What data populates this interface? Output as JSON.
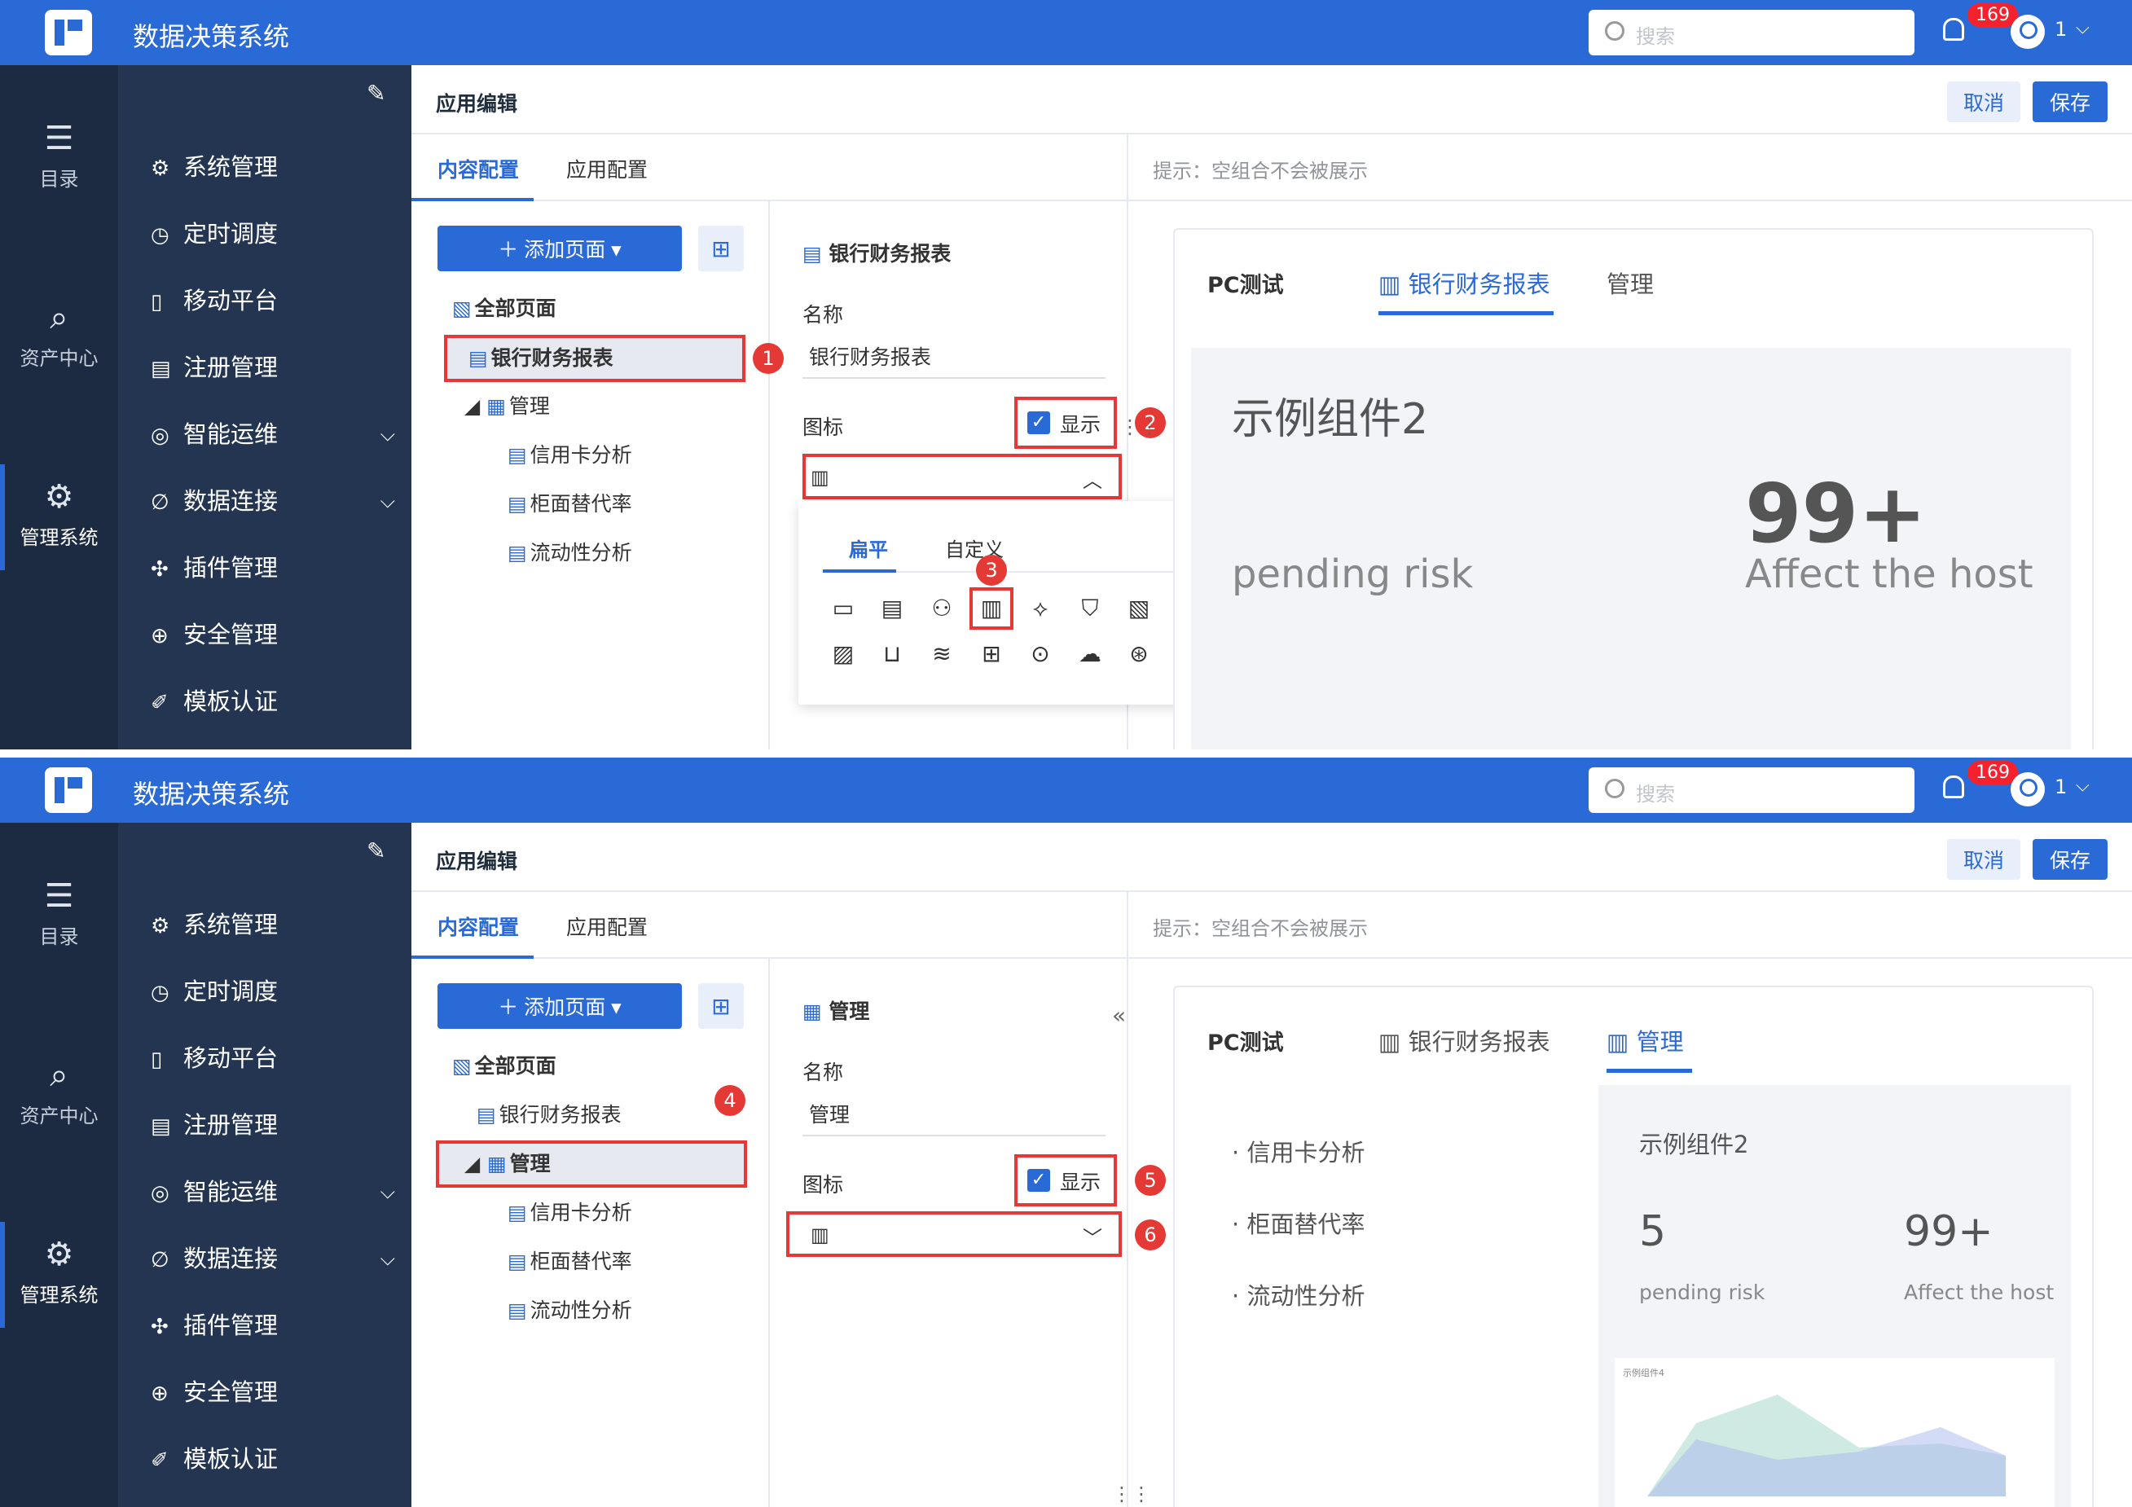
{
  "app": {
    "title": "数据决策系统",
    "search_placeholder": "搜索",
    "notif_count": "169",
    "user": "1"
  },
  "rail": [
    {
      "label": "目录"
    },
    {
      "label": "资产中心"
    },
    {
      "label": "管理系统"
    }
  ],
  "menu": [
    "系统管理",
    "定时调度",
    "移动平台",
    "注册管理",
    "智能运维",
    "数据连接",
    "插件管理",
    "安全管理",
    "模板认证"
  ],
  "editor": {
    "title": "应用编辑",
    "cancel": "取消",
    "save": "保存",
    "tab_content": "内容配置",
    "tab_app": "应用配置",
    "tip": "提示：空组合不会被展示"
  },
  "tree": {
    "add_page": "添加页面",
    "all_pages": "全部页面",
    "bank_report": "银行财务报表",
    "manage": "管理",
    "children": [
      "信用卡分析",
      "柜面替代率",
      "流动性分析"
    ]
  },
  "props": {
    "name_label": "名称",
    "icon_label": "图标",
    "show": "显示"
  },
  "screen1": {
    "prop_title": "银行财务报表",
    "name_value": "银行财务报表",
    "popup_tab_flat": "扁平",
    "popup_tab_custom": "自定义"
  },
  "screen2": {
    "prop_title": "管理",
    "name_value": "管理"
  },
  "preview": {
    "brand": "PC测试",
    "tab_bank": "银行财务报表",
    "tab_manage": "管理",
    "widget_title": "示例组件2",
    "metric1_value": "5",
    "metric1_label": "pending risk",
    "metric2_value": "99+",
    "metric2_label": "Affect the host",
    "list": [
      "信用卡分析",
      "柜面替代率",
      "流动性分析"
    ],
    "mini_title": "示例组件4"
  },
  "steps": [
    "1",
    "2",
    "3",
    "4",
    "5",
    "6"
  ]
}
